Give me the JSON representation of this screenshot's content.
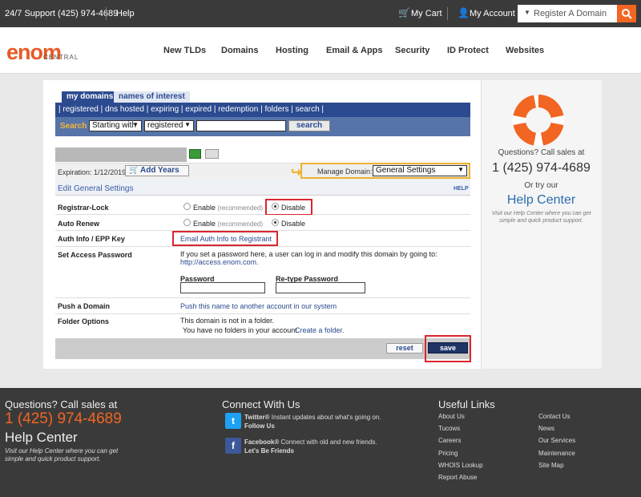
{
  "topbar": {
    "support": "24/7 Support (425) 974-4689",
    "help": "Help",
    "cart": "My Cart",
    "account": "My Account",
    "register_placeholder": "Register A Domain"
  },
  "header": {
    "logo": "enom",
    "logo_sub": "CENTRAL",
    "nav": [
      "New TLDs",
      "Domains",
      "Hosting",
      "Email & Apps",
      "Security",
      "ID Protect",
      "Websites"
    ]
  },
  "tabs": {
    "my_domains": "my domains",
    "names_of_interest": "names of interest"
  },
  "linkbar": {
    "items": [
      "registered",
      "dns hosted",
      "expiring",
      "expired",
      "redemption",
      "folders",
      "search"
    ]
  },
  "search": {
    "label": "Search",
    "mode": "Starting with",
    "scope": "registered",
    "query": "",
    "button": "search"
  },
  "domain": {
    "expiration_label": "Expiration:",
    "expiration": "1/12/2019",
    "add_years": "Add Years",
    "manage_label": "Manage Domain:",
    "manage_value": "General Settings"
  },
  "edit": {
    "title": "Edit General Settings",
    "help": "HELP"
  },
  "settings": {
    "registrar_lock": {
      "label": "Registrar-Lock",
      "enable": "Enable",
      "rec": "(recommended)",
      "disable": "Disable",
      "selected": "Disable"
    },
    "auto_renew": {
      "label": "Auto Renew",
      "enable": "Enable",
      "rec": "(recommended)",
      "disable": "Disable",
      "selected": "Disable"
    },
    "auth_info": {
      "label": "Auth Info / EPP Key",
      "link": "Email Auth Info to Registrant"
    },
    "access_password": {
      "label": "Set Access Password",
      "desc1": "If you set a password here, a user can log in and modify this domain by going to:",
      "url": "http://access.enom.com.",
      "password_label": "Password",
      "retype_label": "Re-type Password"
    },
    "push": {
      "label": "Push a Domain",
      "link": "Push this name to another account in our system"
    },
    "folder": {
      "label": "Folder Options",
      "line1": "This domain is not in a folder.",
      "line2": "You have no folders in your account.",
      "create_link": "Create a folder."
    }
  },
  "buttons": {
    "reset": "reset",
    "save": "save"
  },
  "side": {
    "questions": "Questions? Call sales at",
    "phone": "1 (425) 974-4689",
    "or_try": "Or try our",
    "help_center": "Help Center",
    "desc1": "Visit our Help Center where you can get",
    "desc2": "simple and quick product support."
  },
  "footer": {
    "questions": "Questions? Call sales at",
    "phone": "1 (425) 974-4689",
    "help_center": "Help Center",
    "desc1": "Visit our Help Center where you can get",
    "desc2": "simple and quick product support.",
    "connect_title": "Connect With Us",
    "twitter": {
      "name": "Twitter®",
      "text": "Instant updates about what's going on.",
      "action": "Follow Us"
    },
    "facebook": {
      "name": "Facebook®",
      "text": "Connect with old and new friends.",
      "action": "Let's Be Friends"
    },
    "useful_title": "Useful Links",
    "links_col1": [
      "About Us",
      "Tucows",
      "Careers",
      "Pricing",
      "WHOIS Lookup",
      "Report Abuse"
    ],
    "links_col2": [
      "Contact Us",
      "News",
      "Our Services",
      "Maintenance",
      "Site Map"
    ]
  },
  "colors": {
    "brand_orange": "#f26522",
    "nav_blue": "#2b4a8f",
    "highlight_red": "#d9262e",
    "save_blue": "#1f3566"
  }
}
